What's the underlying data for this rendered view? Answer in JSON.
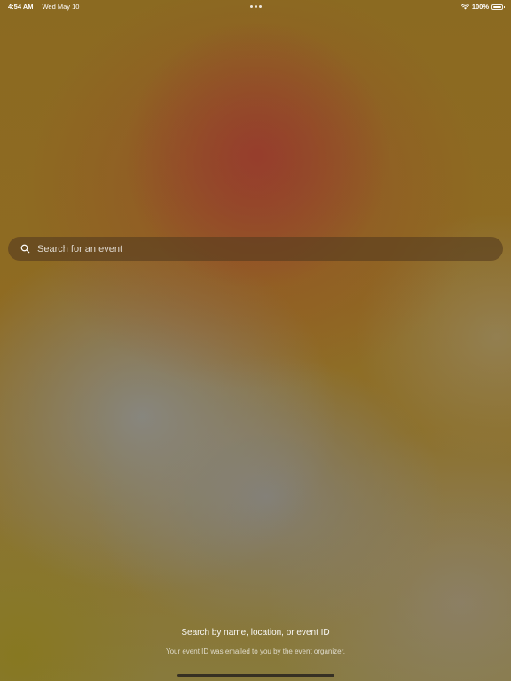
{
  "status_bar": {
    "time": "4:54 AM",
    "date": "Wed May 10",
    "battery": "100%",
    "battery_level": 1.0,
    "wifi_icon": "wifi-icon",
    "battery_icon": "battery-icon",
    "multitask_icon": "three-dots-icon"
  },
  "search": {
    "placeholder": "Search for an event",
    "value": "",
    "icon": "search-icon"
  },
  "hint": {
    "primary": "Search by name, location, or event ID",
    "secondary": "Your event ID was emailed to you by the event organizer."
  },
  "colors": {
    "search_bar_bg": "#553c1e",
    "text": "#ffffff"
  }
}
